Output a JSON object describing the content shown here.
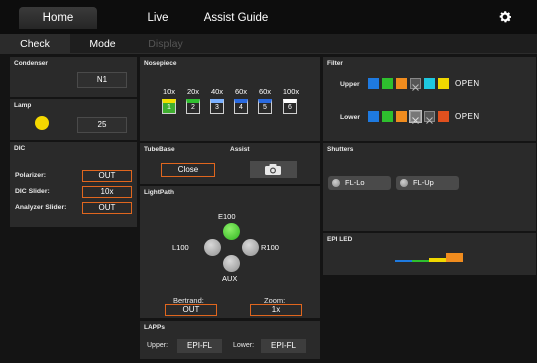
{
  "topnav": {
    "tabs": [
      {
        "label": "Home",
        "active": true
      },
      {
        "label": "Live",
        "active": false
      },
      {
        "label": "Assist Guide",
        "active": false
      }
    ],
    "settings_icon": "gear-icon"
  },
  "subnav": {
    "tabs": [
      {
        "label": "Check",
        "active": true
      },
      {
        "label": "Mode",
        "active": false
      },
      {
        "label": "Display",
        "disabled": true
      }
    ]
  },
  "condenser": {
    "title": "Condenser",
    "value": "N1"
  },
  "lamp": {
    "title": "Lamp",
    "value": "25",
    "indicator_color": "#f5d800"
  },
  "dic": {
    "title": "DIC",
    "rows": [
      {
        "label": "Polarizer:",
        "value": "OUT"
      },
      {
        "label": "DIC Slider:",
        "value": "10x"
      },
      {
        "label": "Analyzer Slider:",
        "value": "OUT"
      }
    ]
  },
  "nosepiece": {
    "title": "Nosepiece",
    "objectives": [
      {
        "mag": "10x",
        "slot": "1",
        "color": "#f0e000",
        "selected": true
      },
      {
        "mag": "20x",
        "slot": "2",
        "color": "#30c030"
      },
      {
        "mag": "40x",
        "slot": "3",
        "color": "#7ab0ff"
      },
      {
        "mag": "60x",
        "slot": "4",
        "color": "#2a6ae0"
      },
      {
        "mag": "60x",
        "slot": "5",
        "color": "#2a6ae0"
      },
      {
        "mag": "100x",
        "slot": "6",
        "color": "#ffffff"
      }
    ]
  },
  "filter": {
    "title": "Filter",
    "upper": {
      "label": "Upper",
      "status": "OPEN",
      "squares": [
        "#1e7ae0",
        "#2ec02e",
        "#f08c1e",
        "x",
        "#1ec8e0",
        "#f0d800"
      ]
    },
    "lower": {
      "label": "Lower",
      "status": "OPEN",
      "squares": [
        "#1e7ae0",
        "#2ec02e",
        "#f08c1e",
        "x",
        "x",
        "#e0501e"
      ]
    }
  },
  "tubebase": {
    "title": "TubeBase",
    "value": "Close"
  },
  "assist": {
    "title": "Assist",
    "camera_icon": "camera-icon"
  },
  "shutters": {
    "title": "Shutters",
    "buttons": [
      {
        "label": "FL-Lo"
      },
      {
        "label": "FL-Up"
      }
    ]
  },
  "lightpath": {
    "title": "LightPath",
    "top": "E100",
    "left": "L100",
    "right": "R100",
    "bottom": "AUX",
    "bertrand": {
      "label": "Bertrand:",
      "value": "OUT"
    },
    "zoom": {
      "label": "Zoom:",
      "value": "1x"
    }
  },
  "epi_led": {
    "title": "EPI LED",
    "levels": [
      {
        "color": "#1e7ae0",
        "level": 0.1
      },
      {
        "color": "#2ec02e",
        "level": 0.2
      },
      {
        "color": "#f0d800",
        "level": 0.4
      },
      {
        "color": "#f08c1e",
        "level": 0.9
      }
    ]
  },
  "lapps": {
    "title": "LAPPs",
    "upper": {
      "label": "Upper:",
      "value": "EPI-FL"
    },
    "lower": {
      "label": "Lower:",
      "value": "EPI-FL"
    }
  }
}
